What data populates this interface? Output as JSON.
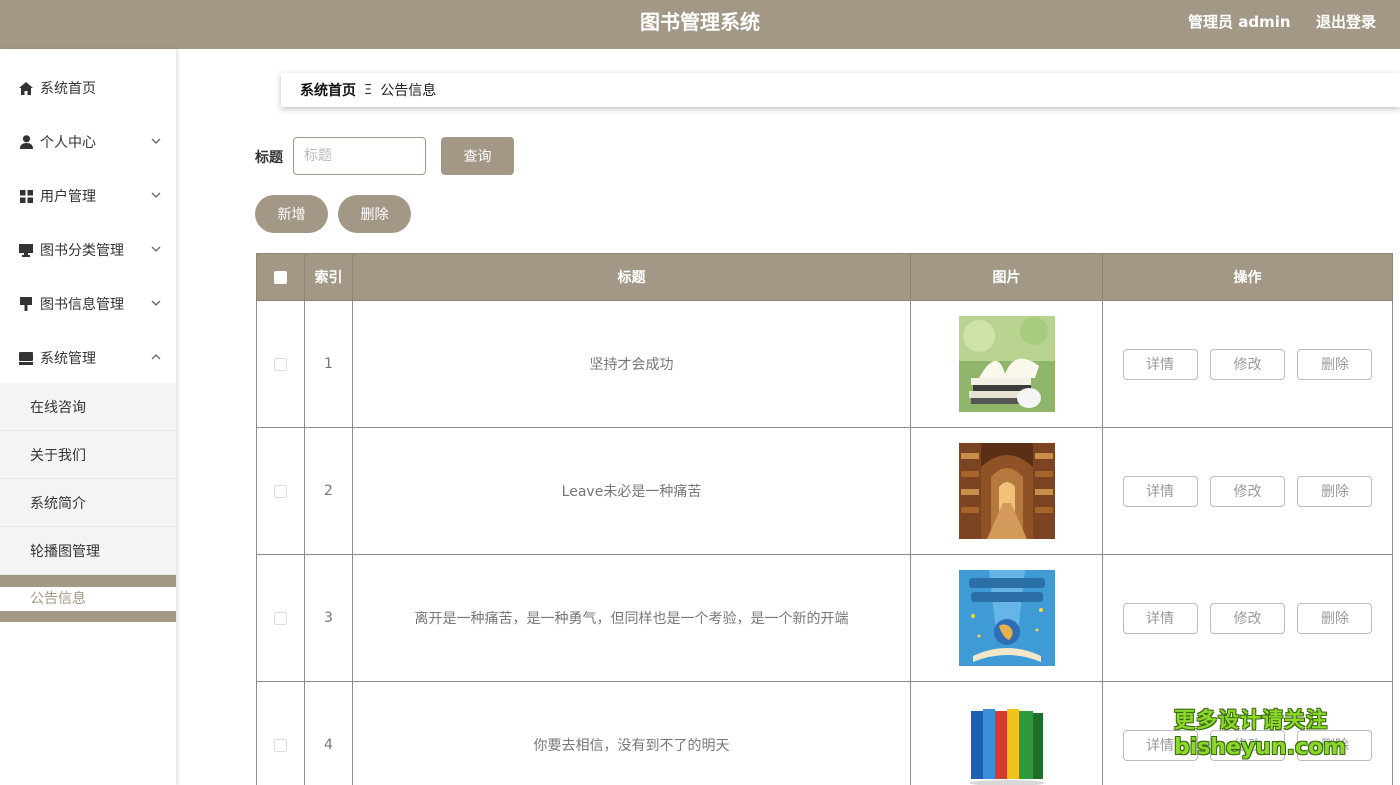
{
  "header": {
    "title": "图书管理系统",
    "user": "管理员 admin",
    "logout": "退出登录"
  },
  "sidebar": {
    "items": [
      {
        "label": "系统首页",
        "icon": "home-icon"
      },
      {
        "label": "个人中心",
        "icon": "user-icon"
      },
      {
        "label": "用户管理",
        "icon": "grid-icon"
      },
      {
        "label": "图书分类管理",
        "icon": "monitor-icon"
      },
      {
        "label": "图书信息管理",
        "icon": "brush-icon"
      },
      {
        "label": "系统管理",
        "icon": "inbox-icon"
      }
    ],
    "submenu": [
      "在线咨询",
      "关于我们",
      "系统简介",
      "轮播图管理"
    ],
    "active": "公告信息"
  },
  "breadcrumb": {
    "home": "系统首页",
    "separator": "Ξ",
    "current": "公告信息"
  },
  "search": {
    "label": "标题",
    "placeholder": "标题",
    "button": "查询"
  },
  "actions": {
    "add": "新增",
    "delete": "删除"
  },
  "table": {
    "columns": [
      "",
      "索引",
      "标题",
      "图片",
      "操作"
    ],
    "rows": [
      {
        "index": "1",
        "title": "坚持才会成功"
      },
      {
        "index": "2",
        "title": "Leave未必是一种痛苦"
      },
      {
        "index": "3",
        "title": "离开是一种痛苦，是一种勇气，但同样也是一个考验，是一个新的开端"
      },
      {
        "index": "4",
        "title": "你要去相信，没有到不了的明天"
      }
    ],
    "buttons": {
      "detail": "详情",
      "edit": "修改",
      "delete": "删除"
    }
  },
  "watermark": {
    "line1": "更多设计请关注",
    "line2": "bisheyun.com"
  },
  "colors": {
    "primary": "#a39886",
    "white": "#ffffff",
    "watermark": "#8bd82b"
  }
}
